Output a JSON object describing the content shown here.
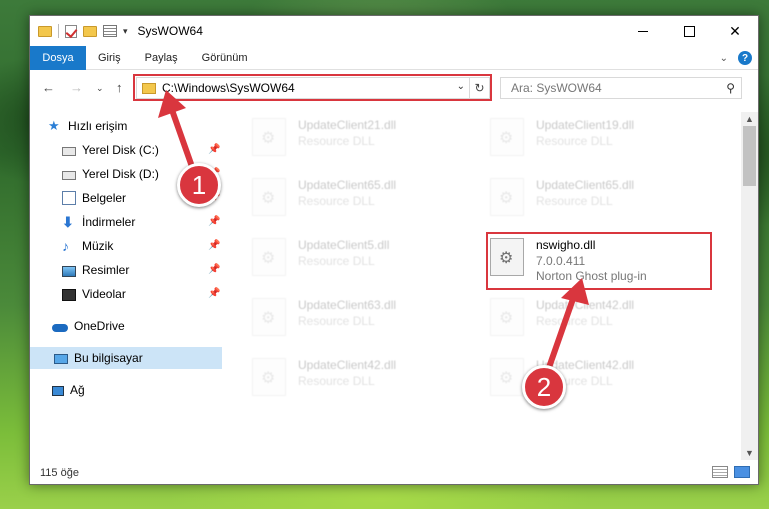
{
  "window": {
    "title": "SysWOW64",
    "controls": {
      "minimize": "",
      "maximize": "",
      "close": "✕"
    }
  },
  "ribbon": {
    "tabs": [
      "Dosya",
      "Giriş",
      "Paylaş",
      "Görünüm"
    ],
    "help": "?"
  },
  "navigation": {
    "address": "C:\\Windows\\SysWOW64",
    "search_placeholder": "Ara: SysWOW64"
  },
  "sidebar": {
    "items": [
      {
        "label": "Hızlı erişim",
        "icon": "star-icon",
        "pinned": false
      },
      {
        "label": "Yerel Disk (C:)",
        "icon": "disk-icon",
        "pinned": true
      },
      {
        "label": "Yerel Disk (D:)",
        "icon": "disk-icon",
        "pinned": true
      },
      {
        "label": "Belgeler",
        "icon": "documents-icon",
        "pinned": true
      },
      {
        "label": "İndirmeler",
        "icon": "download-icon",
        "pinned": true
      },
      {
        "label": "Müzik",
        "icon": "music-icon",
        "pinned": true
      },
      {
        "label": "Resimler",
        "icon": "pictures-icon",
        "pinned": true
      },
      {
        "label": "Videolar",
        "icon": "videos-icon",
        "pinned": true
      },
      {
        "label": "OneDrive",
        "icon": "onedrive-icon",
        "pinned": false
      },
      {
        "label": "Bu bilgisayar",
        "icon": "computer-icon",
        "pinned": false,
        "selected": true
      },
      {
        "label": "Ağ",
        "icon": "network-icon",
        "pinned": false
      }
    ]
  },
  "files": [
    {
      "name": "UpdateClient21.dll",
      "desc": "Resource DLL"
    },
    {
      "name": "UpdateClient19.dll",
      "desc": "Resource DLL"
    },
    {
      "name": "UpdateClient65.dll",
      "desc": "Resource DLL"
    },
    {
      "name": "UpdateClient65.dll",
      "desc": "Resource DLL"
    },
    {
      "name": "UpdateClient5.dll",
      "desc": "Resource DLL"
    },
    {
      "name": "nswigho.dll",
      "version": "7.0.0.411",
      "desc": "Norton Ghost plug-in"
    },
    {
      "name": "UpdateClient63.dll",
      "desc": "Resource DLL"
    },
    {
      "name": "UpdateClient42.dll",
      "desc": "Resource DLL"
    },
    {
      "name": "UpdateClient42.dll",
      "desc": "Resource DLL"
    },
    {
      "name": "UpdateClient42.dll",
      "desc": "Resource DLL"
    }
  ],
  "status": {
    "count": "115 öğe"
  },
  "annotations": {
    "step1": "1",
    "step2": "2",
    "color": "#d9363e"
  }
}
